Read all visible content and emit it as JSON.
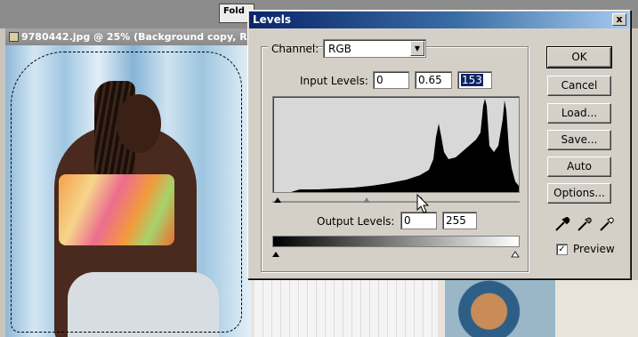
{
  "background": {
    "folder_tab_label": "Fold",
    "document_title": "9780442.jpg @ 25% (Background copy, R"
  },
  "dialog": {
    "title": "Levels",
    "close_label": "x",
    "channel": {
      "label": "Channel:",
      "value": "RGB"
    },
    "input_levels": {
      "label": "Input Levels:",
      "black": "0",
      "gamma": "0.65",
      "white": "153"
    },
    "output_levels": {
      "label": "Output Levels:",
      "black": "0",
      "white": "255"
    },
    "buttons": {
      "ok": "OK",
      "cancel": "Cancel",
      "load": "Load...",
      "save": "Save...",
      "auto": "Auto",
      "options": "Options..."
    },
    "preview": {
      "label": "Preview",
      "checked": true
    },
    "icons": [
      "black-eyedropper-icon",
      "gray-eyedropper-icon",
      "white-eyedropper-icon"
    ],
    "colors": {
      "titlebar_start": "#0a246a",
      "titlebar_end": "#a6caf0",
      "dialog_bg": "#d4d0c8",
      "selection": "#0a246a"
    }
  }
}
